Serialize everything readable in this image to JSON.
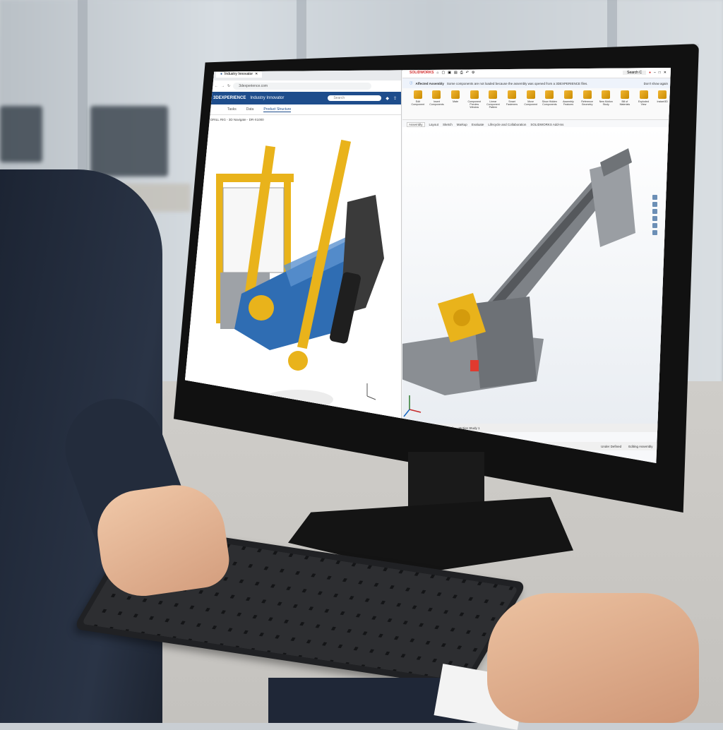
{
  "browser": {
    "tab_title": "Industry Innovator",
    "url": "3dexperience.com",
    "app_brand": "3DEXPERIENCE",
    "app_name": "Industry Innovator",
    "search_placeholder": "Search",
    "tabs": [
      "Tasks",
      "Data",
      "Product Structure"
    ],
    "active_tab": "Product Structure",
    "breadcrumb": "DRILL RIG - 3D Navigate - DR-X1000"
  },
  "cad": {
    "logo": "SOLIDWORKS",
    "search_placeholder": "Search C",
    "info_text": "Some components are not loaded because the assembly was opened from a 3DEXPERIENCE files.",
    "info_label": "Affected Assembly",
    "dont_show": "Don't show again",
    "ribbon": [
      "Edit Component",
      "Insert Components",
      "Mate",
      "Component Preview Window",
      "Linear Component Pattern",
      "Smart Fasteners",
      "Move Component",
      "Show Hidden Components",
      "Assembly Features",
      "Reference Geometry",
      "New Motion Study",
      "Bill of Materials",
      "Exploded View",
      "Instant3D"
    ],
    "command_tabs": [
      "Assembly",
      "Layout",
      "Sketch",
      "Markup",
      "Evaluate",
      "Lifecycle and Collaboration",
      "SOLIDWORKS Add-Ins"
    ],
    "active_command_tab": "Assembly",
    "bottom_tabs": [
      "SOLIDWORKS",
      "Model",
      "Motion Study 1"
    ],
    "status": [
      "Under Defined",
      "Editing Assembly",
      "Custom"
    ]
  },
  "colors": {
    "brand_blue": "#1e4d8c",
    "part_yellow": "#e9b31b",
    "part_blue": "#2f6db3",
    "part_gray": "#8d9196"
  }
}
